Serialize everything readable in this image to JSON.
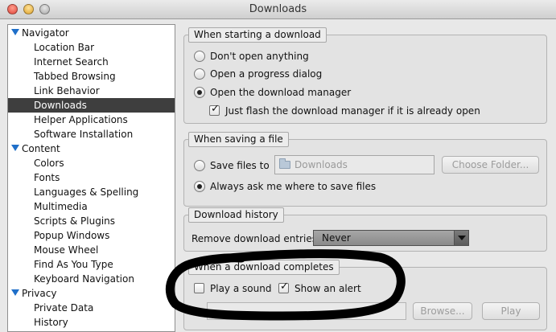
{
  "window": {
    "title": "Downloads"
  },
  "sidebar": {
    "groups": [
      {
        "label": "Navigator",
        "items": [
          "Location Bar",
          "Internet Search",
          "Tabbed Browsing",
          "Link Behavior",
          "Downloads",
          "Helper Applications",
          "Software Installation"
        ]
      },
      {
        "label": "Content",
        "items": [
          "Colors",
          "Fonts",
          "Languages & Spelling",
          "Multimedia",
          "Scripts & Plugins",
          "Popup Windows",
          "Mouse Wheel",
          "Find As You Type",
          "Keyboard Navigation"
        ]
      },
      {
        "label": "Privacy",
        "items": [
          "Private Data",
          "History"
        ]
      }
    ],
    "selected": "Downloads"
  },
  "start_download": {
    "legend": "When starting a download",
    "options": [
      "Don't open anything",
      "Open a progress dialog",
      "Open the download manager"
    ],
    "selected_index": 2,
    "flash_label": "Just flash the download manager if it is already open",
    "flash_checked": true
  },
  "saving": {
    "legend": "When saving a file",
    "save_files_label": "Save files to",
    "folder_value": "Downloads",
    "choose_folder_label": "Choose Folder...",
    "ask_label": "Always ask me where to save files",
    "selected": "ask"
  },
  "history": {
    "legend": "Download history",
    "remove_label": "Remove download entries",
    "remove_value": "Never"
  },
  "completes": {
    "legend": "When a download completes",
    "play_sound_label": "Play a sound",
    "play_sound_checked": false,
    "show_alert_label": "Show an alert",
    "show_alert_checked": true,
    "browse_label": "Browse...",
    "play_label": "Play"
  },
  "colors": {
    "selection": "#3e3e3e",
    "disclosure": "#1f6fc9",
    "annotation": "#000000"
  }
}
